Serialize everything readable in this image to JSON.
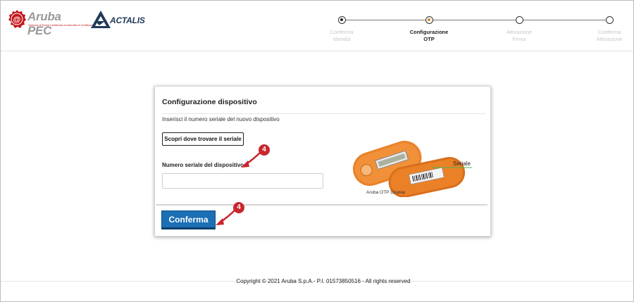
{
  "header": {
    "aruba_logo_text": "Aruba PEC",
    "aruba_logo_tagline": "Gestore di Posta Certificata ed Autorità di Certificazione",
    "actalis_logo_text": "ACTALIS"
  },
  "stepper": {
    "steps": [
      {
        "line1": "Conferma",
        "line2": "Identità",
        "state": "done"
      },
      {
        "line1": "Configurazione",
        "line2": "OTP",
        "state": "current"
      },
      {
        "line1": "Attivazione",
        "line2": "Firma",
        "state": "pending"
      },
      {
        "line1": "Conferma",
        "line2": "Attivazione",
        "state": "pending"
      }
    ]
  },
  "card": {
    "title": "Configurazione dispositivo",
    "instruction": "Inserisci il numero seriale del nuovo dispositivo",
    "find_serial_button": "Scopri dove trovare il seriale",
    "serial_label": "Numero seriale del dispositivo",
    "serial_input_value": "",
    "device_caption": "Aruba OTP Display",
    "device_serial_label": "Seriale",
    "confirm_button": "Conferma"
  },
  "annotations": {
    "badge_serial": "4",
    "badge_confirm": "4"
  },
  "footer": {
    "copyright": "Copyright © 2021 Aruba S.p.A.- P.I. 01573850516 - All rights reserved"
  },
  "colors": {
    "primary_button": "#1b6fb5",
    "active_step": "#e0821e",
    "annotation_red": "#c9252d",
    "device_orange": "#e8822a",
    "serial_line": "#4cb84c"
  }
}
